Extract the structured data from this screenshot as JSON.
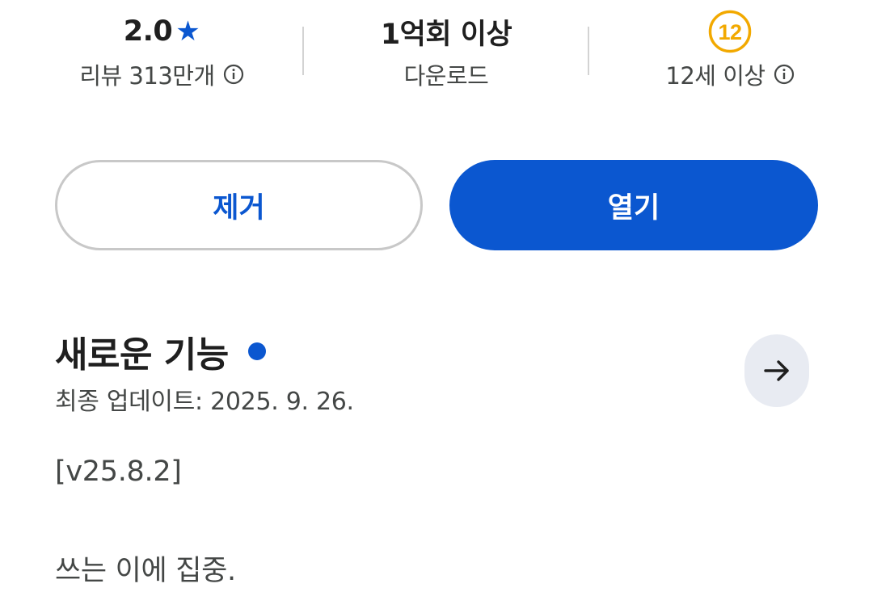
{
  "stats": {
    "rating": {
      "value": "2.0",
      "icon": "star-icon",
      "reviews_label": "리뷰 313만개"
    },
    "downloads": {
      "value": "1억회 이상",
      "label": "다운로드"
    },
    "age": {
      "badge": "12",
      "label": "12세 이상"
    }
  },
  "actions": {
    "remove_label": "제거",
    "open_label": "열기"
  },
  "whats_new": {
    "title": "새로운 기능",
    "last_updated": "최종 업데이트: 2025. 9. 26.",
    "version": "[v25.8.2]",
    "description": "쓰는 이에 집중."
  },
  "colors": {
    "accent": "#0b57d0",
    "age_badge": "#f2a900",
    "text_primary": "#1f1f1f",
    "text_secondary": "#444746",
    "arrow_button_bg": "#e8ebf2"
  }
}
